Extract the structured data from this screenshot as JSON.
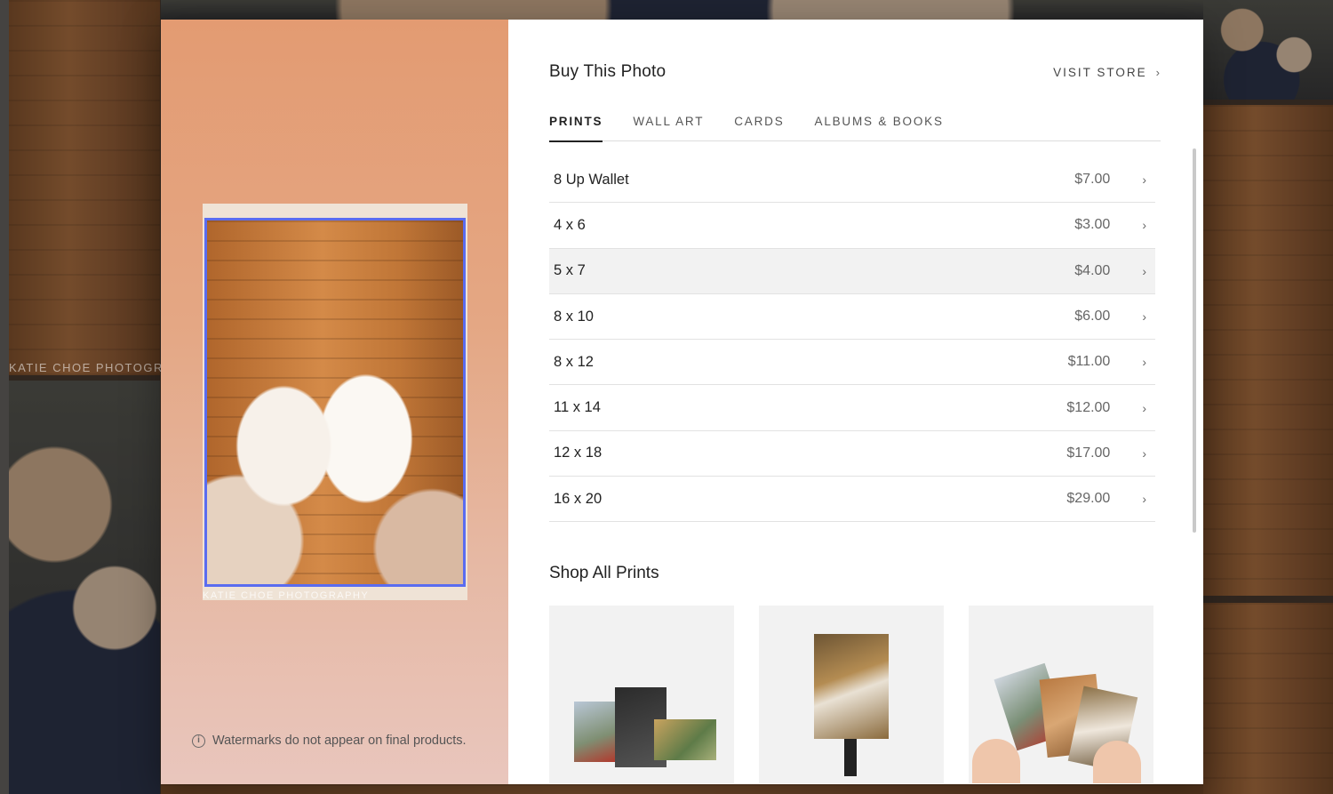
{
  "background": {
    "watermark_text": "KATIE CHOE PHOTOGRA"
  },
  "preview": {
    "photo_watermark": "KATIE CHOE PHOTOGRAPHY",
    "note": "Watermarks do not appear on final products.",
    "info_icon": "info-icon"
  },
  "shop": {
    "title": "Buy This Photo",
    "visit_store": "VISIT STORE",
    "tabs": [
      {
        "label": "PRINTS",
        "active": true
      },
      {
        "label": "WALL ART",
        "active": false
      },
      {
        "label": "CARDS",
        "active": false
      },
      {
        "label": "ALBUMS & BOOKS",
        "active": false
      }
    ],
    "products": [
      {
        "size": "8 Up Wallet",
        "price": "$7.00"
      },
      {
        "size": "4 x 6",
        "price": "$3.00"
      },
      {
        "size": "5 x 7",
        "price": "$4.00"
      },
      {
        "size": "8 x 10",
        "price": "$6.00"
      },
      {
        "size": "8 x 12",
        "price": "$11.00"
      },
      {
        "size": "11 x 14",
        "price": "$12.00"
      },
      {
        "size": "12 x 18",
        "price": "$17.00"
      },
      {
        "size": "16 x 20",
        "price": "$29.00"
      }
    ],
    "shop_all_title": "Shop All Prints",
    "colors": {
      "crop_outline": "#5a6cf0",
      "hover_row": "#f2f2f2"
    }
  }
}
